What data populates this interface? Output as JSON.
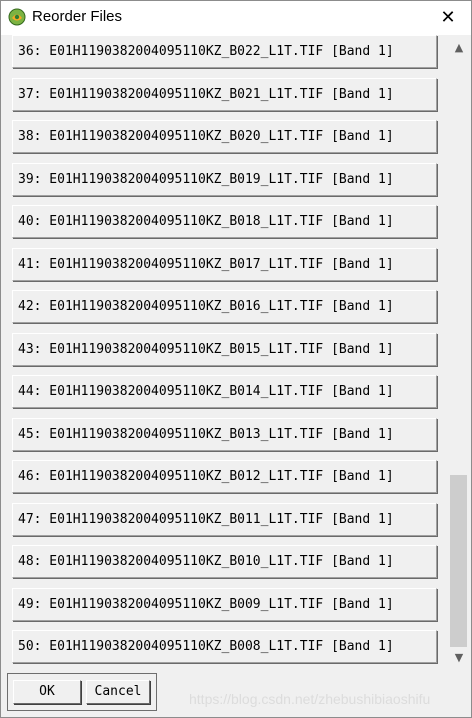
{
  "window": {
    "title": "Reorder Files",
    "close_glyph": "✕"
  },
  "icons": {
    "app": "app-logo-icon",
    "close": "close-icon",
    "scroll_up": "scroll-up-arrow-icon",
    "scroll_down": "scroll-down-arrow-icon"
  },
  "files": [
    "36: E01H1190382004095110KZ_B022_L1T.TIF [Band 1]",
    "37: E01H1190382004095110KZ_B021_L1T.TIF [Band 1]",
    "38: E01H1190382004095110KZ_B020_L1T.TIF [Band 1]",
    "39: E01H1190382004095110KZ_B019_L1T.TIF [Band 1]",
    "40: E01H1190382004095110KZ_B018_L1T.TIF [Band 1]",
    "41: E01H1190382004095110KZ_B017_L1T.TIF [Band 1]",
    "42: E01H1190382004095110KZ_B016_L1T.TIF [Band 1]",
    "43: E01H1190382004095110KZ_B015_L1T.TIF [Band 1]",
    "44: E01H1190382004095110KZ_B014_L1T.TIF [Band 1]",
    "45: E01H1190382004095110KZ_B013_L1T.TIF [Band 1]",
    "46: E01H1190382004095110KZ_B012_L1T.TIF [Band 1]",
    "47: E01H1190382004095110KZ_B011_L1T.TIF [Band 1]",
    "48: E01H1190382004095110KZ_B010_L1T.TIF [Band 1]",
    "49: E01H1190382004095110KZ_B009_L1T.TIF [Band 1]",
    "50: E01H1190382004095110KZ_B008_L1T.TIF [Band 1]"
  ],
  "buttons": {
    "ok": "OK",
    "cancel": "Cancel"
  },
  "watermark": "https://blog.csdn.net/zhebushibiaoshifu"
}
